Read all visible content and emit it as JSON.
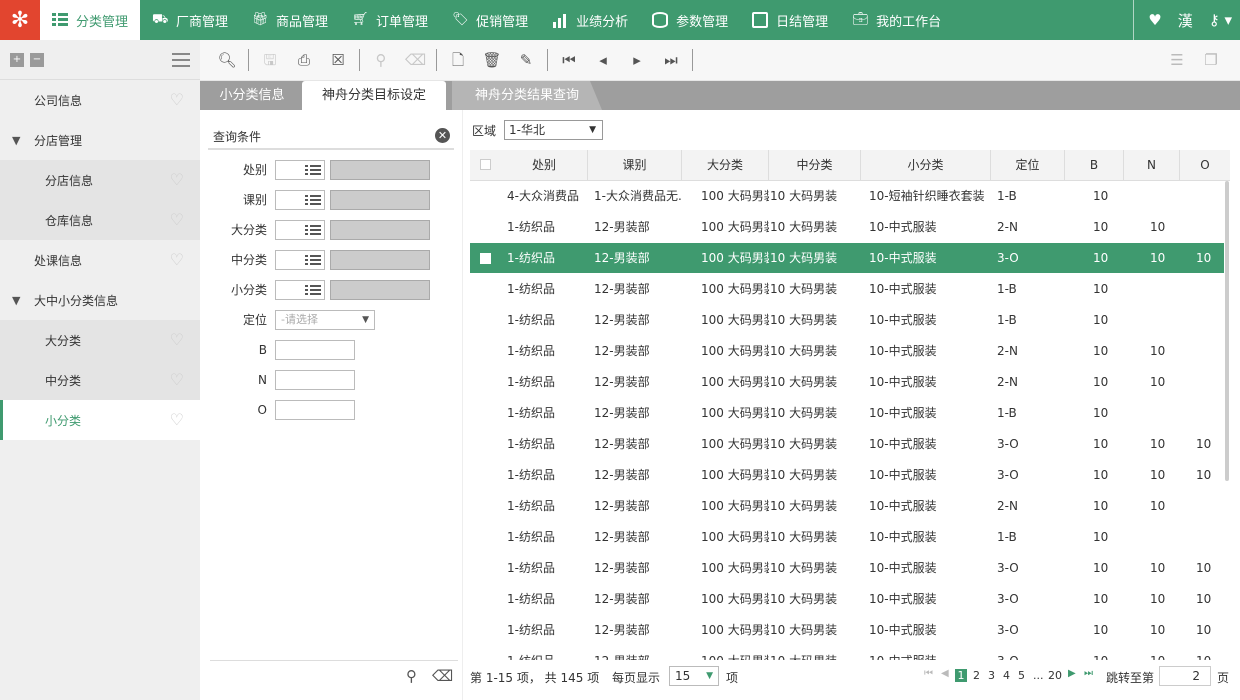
{
  "topnav": {
    "items": [
      {
        "label": "分类管理",
        "icon": "grid-list-icon"
      },
      {
        "label": "厂商管理",
        "icon": "truck-icon"
      },
      {
        "label": "商品管理",
        "icon": "gift-icon"
      },
      {
        "label": "订单管理",
        "icon": "cart-icon"
      },
      {
        "label": "促销管理",
        "icon": "tag-icon"
      },
      {
        "label": "业绩分析",
        "icon": "bar-chart-icon"
      },
      {
        "label": "参数管理",
        "icon": "database-icon"
      },
      {
        "label": "日结管理",
        "icon": "calendar-icon"
      },
      {
        "label": "我的工作台",
        "icon": "briefcase-icon"
      }
    ],
    "lang": "漢",
    "colors": {
      "primary": "#3f9a6f",
      "logo": "#e2452f"
    }
  },
  "sidebar": {
    "items": [
      {
        "label": "公司信息"
      },
      {
        "label": "分店管理"
      },
      {
        "label": "分店信息"
      },
      {
        "label": "仓库信息"
      },
      {
        "label": "处课信息"
      },
      {
        "label": "大中小分类信息"
      },
      {
        "label": "大分类"
      },
      {
        "label": "中分类"
      },
      {
        "label": "小分类"
      }
    ]
  },
  "tabs": [
    {
      "label": "小分类信息"
    },
    {
      "label": "神舟分类目标设定"
    },
    {
      "label": "神舟分类结果查询"
    }
  ],
  "query": {
    "title": "查询条件",
    "fields": [
      {
        "label": "处别"
      },
      {
        "label": "课别"
      },
      {
        "label": "大分类"
      },
      {
        "label": "中分类"
      },
      {
        "label": "小分类"
      },
      {
        "label": "定位",
        "placeholder": "-请选择"
      },
      {
        "label": "B"
      },
      {
        "label": "N"
      },
      {
        "label": "O"
      }
    ]
  },
  "area": {
    "label": "区域",
    "value": "1-华北"
  },
  "grid": {
    "columns": [
      "处别",
      "课别",
      "大分类",
      "中分类",
      "小分类",
      "定位",
      "B",
      "N",
      "O"
    ],
    "selected_row": 2,
    "rows": [
      [
        "4-大众消费品",
        "1-大众消费品无...",
        "100 大码男装",
        "10 大码男装",
        "10-短袖针织睡衣套装",
        "1-B",
        "10",
        "",
        ""
      ],
      [
        "1-纺织品",
        "12-男装部",
        "100 大码男装",
        "10 大码男装",
        "10-中式服装",
        "2-N",
        "10",
        "10",
        ""
      ],
      [
        "1-纺织品",
        "12-男装部",
        "100 大码男装",
        "10 大码男装",
        "10-中式服装",
        "3-O",
        "10",
        "10",
        "10"
      ],
      [
        "1-纺织品",
        "12-男装部",
        "100 大码男装",
        "10 大码男装",
        "10-中式服装",
        "1-B",
        "10",
        "",
        ""
      ],
      [
        "1-纺织品",
        "12-男装部",
        "100 大码男装",
        "10 大码男装",
        "10-中式服装",
        "1-B",
        "10",
        "",
        ""
      ],
      [
        "1-纺织品",
        "12-男装部",
        "100 大码男装",
        "10 大码男装",
        "10-中式服装",
        "2-N",
        "10",
        "10",
        ""
      ],
      [
        "1-纺织品",
        "12-男装部",
        "100 大码男装",
        "10 大码男装",
        "10-中式服装",
        "2-N",
        "10",
        "10",
        ""
      ],
      [
        "1-纺织品",
        "12-男装部",
        "100 大码男装",
        "10 大码男装",
        "10-中式服装",
        "1-B",
        "10",
        "",
        ""
      ],
      [
        "1-纺织品",
        "12-男装部",
        "100 大码男装",
        "10 大码男装",
        "10-中式服装",
        "3-O",
        "10",
        "10",
        "10"
      ],
      [
        "1-纺织品",
        "12-男装部",
        "100 大码男装",
        "10 大码男装",
        "10-中式服装",
        "3-O",
        "10",
        "10",
        "10"
      ],
      [
        "1-纺织品",
        "12-男装部",
        "100 大码男装",
        "10 大码男装",
        "10-中式服装",
        "2-N",
        "10",
        "10",
        ""
      ],
      [
        "1-纺织品",
        "12-男装部",
        "100 大码男装",
        "10 大码男装",
        "10-中式服装",
        "1-B",
        "10",
        "",
        ""
      ],
      [
        "1-纺织品",
        "12-男装部",
        "100 大码男装",
        "10 大码男装",
        "10-中式服装",
        "3-O",
        "10",
        "10",
        "10"
      ],
      [
        "1-纺织品",
        "12-男装部",
        "100 大码男装",
        "10 大码男装",
        "10-中式服装",
        "3-O",
        "10",
        "10",
        "10"
      ],
      [
        "1-纺织品",
        "12-男装部",
        "100 大码男装",
        "10 大码男装",
        "10-中式服装",
        "3-O",
        "10",
        "10",
        "10"
      ],
      [
        "1-纺织品",
        "12-男装部",
        "100 大码男装",
        "10 大码男装",
        "10-中式服装",
        "3-O",
        "10",
        "10",
        "10"
      ]
    ]
  },
  "pager": {
    "summary": "第 1-15 项， 共 145 项",
    "per_page_label": "每页显示",
    "per_page": "15",
    "unit": "项",
    "pages": [
      "1",
      "2",
      "3",
      "4",
      "5",
      "...",
      "20"
    ],
    "jump_label": "跳转至第",
    "jump_value": "2",
    "page_unit": "页"
  }
}
